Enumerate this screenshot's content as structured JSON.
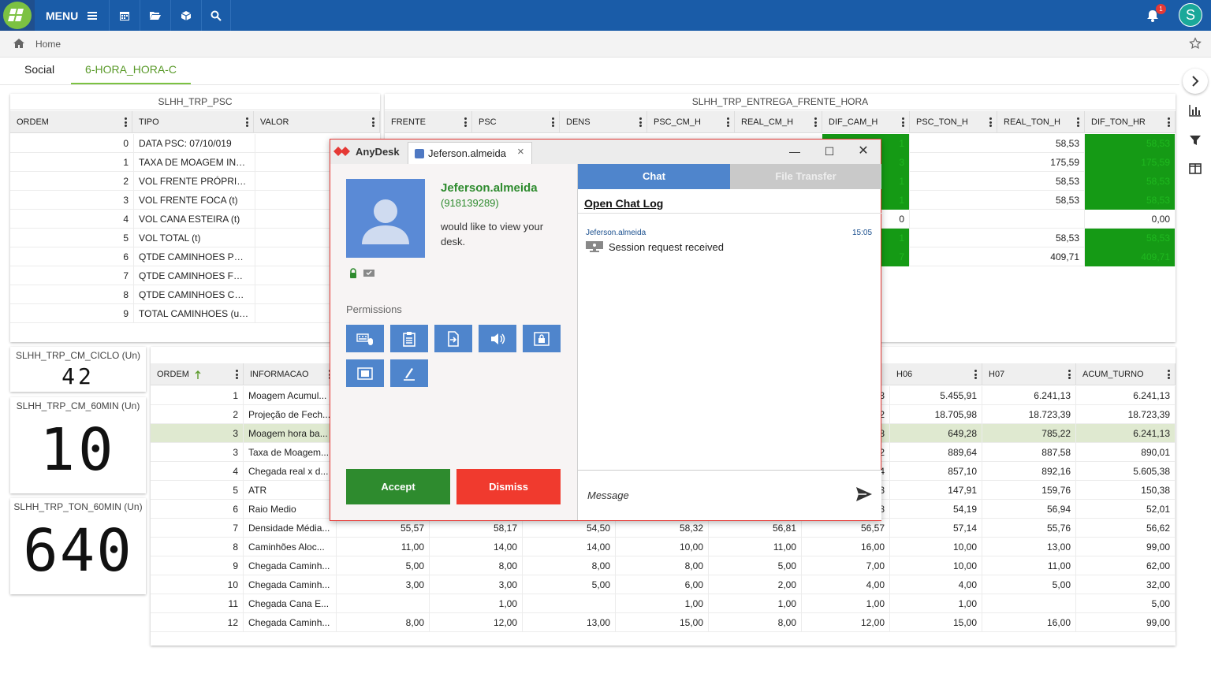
{
  "header": {
    "menu_label": "MENU",
    "notification_count": "1",
    "user_initial": "S"
  },
  "breadcrumb": {
    "home": "Home"
  },
  "tabs": [
    {
      "label": "Social"
    },
    {
      "label": "6-HORA_HORA-C"
    }
  ],
  "psc_panel": {
    "title": "SLHH_TRP_PSC",
    "columns": [
      "ORDEM",
      "TIPO",
      "VALOR"
    ],
    "rows": [
      [
        "0",
        "DATA PSC: 07/10/019"
      ],
      [
        "1",
        "TAXA DE MOAGEM IND..."
      ],
      [
        "2",
        "VOL FRENTE PRÓPRIA (t)"
      ],
      [
        "3",
        "VOL FRENTE FOCA (t)"
      ],
      [
        "4",
        "VOL CANA ESTEIRA (t)"
      ],
      [
        "5",
        "VOL TOTAL (t)"
      ],
      [
        "6",
        "QTDE CAMINHOES PRO..."
      ],
      [
        "7",
        "QTDE CAMINHOES FOC..."
      ],
      [
        "8",
        "QTDE CAMINHOES CAN..."
      ],
      [
        "9",
        "TOTAL CAMINHOES (un..."
      ]
    ]
  },
  "entrega_panel": {
    "title": "SLHH_TRP_ENTREGA_FRENTE_HORA",
    "columns": [
      "FRENTE",
      "PSC",
      "DENS",
      "PSC_CM_H",
      "REAL_CM_H",
      "DIF_CAM_H",
      "PSC_TON_H",
      "REAL_TON_H",
      "DIF_TON_HR"
    ],
    "rows": [
      {
        "dif_cam": "1",
        "real_ton": "58,53",
        "dif_ton": "58,53",
        "green": true
      },
      {
        "dif_cam": "3",
        "real_ton": "175,59",
        "dif_ton": "175,59",
        "green": true
      },
      {
        "dif_cam": "1",
        "real_ton": "58,53",
        "dif_ton": "58,53",
        "green": true
      },
      {
        "dif_cam": "1",
        "real_ton": "58,53",
        "dif_ton": "58,53",
        "green": true
      },
      {
        "dif_cam": "0",
        "real_ton": "",
        "dif_ton": "0,00",
        "green": false
      },
      {
        "dif_cam": "1",
        "real_ton": "58,53",
        "dif_ton": "58,53",
        "green": true
      },
      {
        "dif_cam": "7",
        "real_ton": "409,71",
        "dif_ton": "409,71",
        "green": true
      }
    ]
  },
  "kpis": [
    {
      "title": "SLHH_TRP_CM_CICLO (Un)",
      "value": "42"
    },
    {
      "title": "SLHH_TRP_CM_60MIN (Un)",
      "value": "10"
    },
    {
      "title": "SLHH_TRP_TON_60MIN (Un)",
      "value": "640"
    }
  ],
  "hourly_panel": {
    "columns": [
      "ORDEM",
      "INFORMACAO",
      "H06",
      "H07",
      "ACUM_TURNO"
    ],
    "rows": [
      [
        "1",
        "Moagem Acumul...",
        "",
        "",
        "",
        "",
        "",
        "53",
        "5.455,91",
        "6.241,13",
        "6.241,13"
      ],
      [
        "2",
        "Projeção de Fech...",
        "",
        "",
        "",
        "",
        "",
        "52",
        "18.705,98",
        "18.723,39",
        "18.723,39"
      ],
      [
        "3",
        "Moagem hora ba...",
        "",
        "",
        "",
        "",
        "",
        "58",
        "649,28",
        "785,22",
        "6.241,13"
      ],
      [
        "3",
        "Taxa de Moagem...",
        "",
        "",
        "",
        "",
        "",
        "92",
        "889,64",
        "887,58",
        "890,01"
      ],
      [
        "4",
        "Chegada real x d...",
        "",
        "",
        "",
        "",
        "",
        "34",
        "857,10",
        "892,16",
        "5.605,38"
      ],
      [
        "5",
        "ATR",
        "",
        "",
        "",
        "",
        "",
        "33",
        "147,91",
        "159,76",
        "150,38"
      ],
      [
        "6",
        "Raio Medio",
        "",
        "",
        "",
        "",
        "",
        "58",
        "54,19",
        "56,94",
        "52,01"
      ],
      [
        "7",
        "Densidade Média...",
        "55,57",
        "58,17",
        "54,50",
        "58,32",
        "56,81",
        "56,57",
        "57,14",
        "55,76",
        "56,62"
      ],
      [
        "8",
        "Caminhões Aloc...",
        "11,00",
        "14,00",
        "14,00",
        "10,00",
        "11,00",
        "16,00",
        "10,00",
        "13,00",
        "99,00"
      ],
      [
        "9",
        "Chegada Caminh...",
        "5,00",
        "8,00",
        "8,00",
        "8,00",
        "5,00",
        "7,00",
        "10,00",
        "11,00",
        "62,00"
      ],
      [
        "10",
        "Chegada Caminh...",
        "3,00",
        "3,00",
        "5,00",
        "6,00",
        "2,00",
        "4,00",
        "4,00",
        "5,00",
        "32,00"
      ],
      [
        "11",
        "Chegada Cana E...",
        "",
        "1,00",
        "",
        "1,00",
        "1,00",
        "1,00",
        "1,00",
        "",
        "5,00"
      ],
      [
        "12",
        "Chegada Caminh...",
        "8,00",
        "12,00",
        "13,00",
        "15,00",
        "8,00",
        "12,00",
        "15,00",
        "16,00",
        "99,00"
      ]
    ],
    "highlight_row": 2
  },
  "anydesk": {
    "brand": "AnyDesk",
    "tab_label": "Jeferson.almeida",
    "caller_name": "Jeferson.almeida",
    "caller_id": "(918139289)",
    "message": "would like to view your desk.",
    "permissions_label": "Permissions",
    "accept_label": "Accept",
    "dismiss_label": "Dismiss",
    "chat_tab": "Chat",
    "file_transfer_tab": "File Transfer",
    "open_chat_log": "Open Chat Log",
    "chat_user": "Jeferson.almeida",
    "chat_time": "15:05",
    "chat_text": "Session request received",
    "message_placeholder": "Message"
  }
}
